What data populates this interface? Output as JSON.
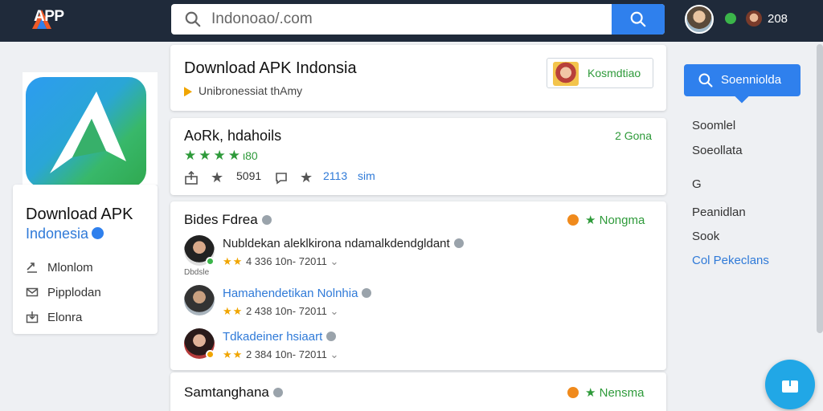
{
  "header": {
    "logo_text": "APP",
    "search": {
      "value": "Indonoao/.com",
      "placeholder": ""
    },
    "count": "208"
  },
  "sidebar": {
    "app_title": "Download APK",
    "app_subtitle": "Indonesia",
    "items": [
      {
        "label": "Mlonlom",
        "icon": "share-icon"
      },
      {
        "label": "Pipplodan",
        "icon": "mail-icon"
      },
      {
        "label": "Elonra",
        "icon": "download-icon"
      }
    ]
  },
  "cards": {
    "intro": {
      "title": "Download APK Indonsia",
      "subtitle": "Unibronessiat thAmy",
      "badge": "Kosmdtiao"
    },
    "rating": {
      "title": "AoRk, hdahoils",
      "right": "2 Gona",
      "stars": "★★★★",
      "count": "ι80",
      "row": [
        "5091",
        "2113",
        "sim"
      ]
    },
    "reviews": {
      "title": "Bides Fdrea",
      "right": "Nongma",
      "items": [
        {
          "name": "Nubldekan aleklkirona ndamalkdendgldant",
          "meta": "4 336 10n- 72011",
          "stars": "★★",
          "caption": "Dbdsle",
          "name_color": "#222222"
        },
        {
          "name": "Hamahendetikan Nolnhia",
          "meta": "2 438 10n- 72011",
          "stars": "★★",
          "caption": "",
          "name_color": "#2f7ad8"
        },
        {
          "name": "Tdkadeiner hsiaart",
          "meta": "2 384 10n- 72011",
          "stars": "★★",
          "caption": "",
          "name_color": "#2f7ad8"
        }
      ]
    },
    "bottom": {
      "title": "Samtanghana",
      "right": "Nensma"
    }
  },
  "right_panel": {
    "button_label": "Soenniolda",
    "items": [
      "Soomlel",
      "Soeollata",
      "G",
      "Peanidlan",
      "Sook",
      "Col Pekeclans"
    ]
  },
  "colors": {
    "topbar": "#1f2a3a",
    "accent": "#2f80ed",
    "green": "#2e9a3a",
    "star": "#f0a500",
    "fab": "#21a7e6"
  }
}
